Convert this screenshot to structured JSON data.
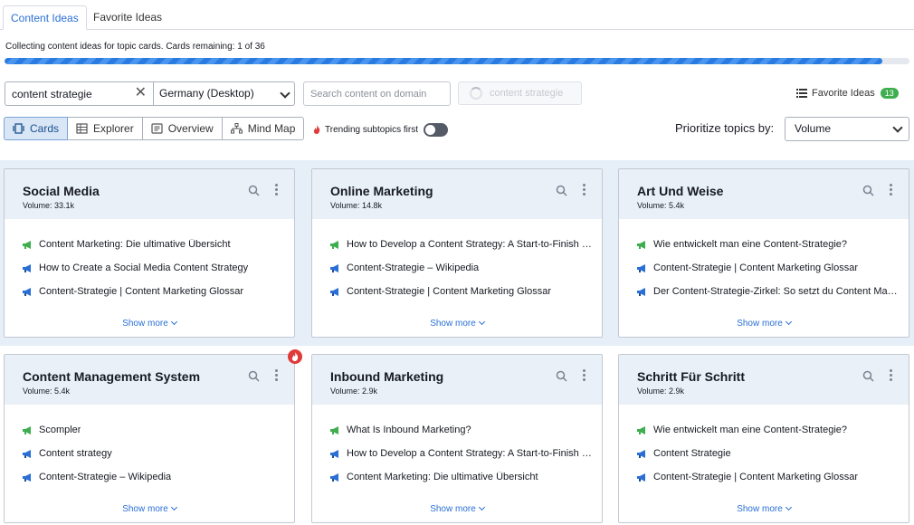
{
  "tabs": [
    "Content Ideas",
    "Favorite Ideas"
  ],
  "progress": {
    "text": "Collecting content ideas for topic cards. Cards remaining: 1 of 36",
    "fraction": 0.97
  },
  "search": {
    "keyword": "content strategie",
    "country": "Germany (Desktop)",
    "domain_placeholder": "Search content on domain",
    "button_label": "content strategie"
  },
  "favorites": {
    "label": "Favorite Ideas",
    "count": "13"
  },
  "views": [
    "Cards",
    "Explorer",
    "Overview",
    "Mind Map"
  ],
  "trending": {
    "label": "Trending subtopics first",
    "enabled": false
  },
  "prioritize": {
    "label": "Prioritize topics by:",
    "value": "Volume"
  },
  "show_more_label": "Show more",
  "colors": {
    "accent": "#2a6fd6",
    "card_header": "#e9f0f8",
    "band": "#e6eef8",
    "badge": "#3fae4f",
    "trend_badge": "#e03a3a"
  },
  "cards": [
    {
      "title": "Social Media",
      "volume": "Volume: 33.1k",
      "trending": false,
      "ideas": [
        {
          "text": "Content Marketing: Die ultimative Übersicht",
          "icon": "megaphone-icon"
        },
        {
          "text": "How to Create a Social Media Content Strategy",
          "icon": "question-icon"
        },
        {
          "text": "Content-Strategie | Content Marketing Glossar",
          "icon": "question-icon"
        }
      ]
    },
    {
      "title": "Online Marketing",
      "volume": "Volume: 14.8k",
      "trending": false,
      "ideas": [
        {
          "text": "How to Develop a Content Strategy: A Start-to-Finish Guide",
          "icon": "megaphone-icon"
        },
        {
          "text": "Content-Strategie – Wikipedia",
          "icon": "question-icon"
        },
        {
          "text": "Content-Strategie | Content Marketing Glossar",
          "icon": "question-icon"
        }
      ]
    },
    {
      "title": "Art Und Weise",
      "volume": "Volume: 5.4k",
      "trending": false,
      "ideas": [
        {
          "text": "Wie entwickelt man eine Content-Strategie?",
          "icon": "megaphone-icon"
        },
        {
          "text": "Content-Strategie | Content Marketing Glossar",
          "icon": "question-icon"
        },
        {
          "text": "Der Content-Strategie-Zirkel: So setzt du Content Marketing um",
          "icon": "question-icon"
        }
      ]
    },
    {
      "title": "Content Management System",
      "volume": "Volume: 5.4k",
      "trending": true,
      "ideas": [
        {
          "text": "Scompler",
          "icon": "megaphone-icon"
        },
        {
          "text": "Content strategy",
          "icon": "question-icon"
        },
        {
          "text": "Content-Strategie – Wikipedia",
          "icon": "question-icon"
        }
      ]
    },
    {
      "title": "Inbound Marketing",
      "volume": "Volume: 2.9k",
      "trending": false,
      "ideas": [
        {
          "text": "What Is Inbound Marketing?",
          "icon": "megaphone-icon"
        },
        {
          "text": "How to Develop a Content Strategy: A Start-to-Finish Guide",
          "icon": "question-icon"
        },
        {
          "text": "Content Marketing: Die ultimative Übersicht",
          "icon": "question-icon"
        }
      ]
    },
    {
      "title": "Schritt Für Schritt",
      "volume": "Volume: 2.9k",
      "trending": false,
      "ideas": [
        {
          "text": "Wie entwickelt man eine Content-Strategie?",
          "icon": "megaphone-icon"
        },
        {
          "text": "Content Strategie",
          "icon": "question-icon"
        },
        {
          "text": "Content-Strategie | Content Marketing Glossar",
          "icon": "question-icon"
        }
      ]
    }
  ]
}
